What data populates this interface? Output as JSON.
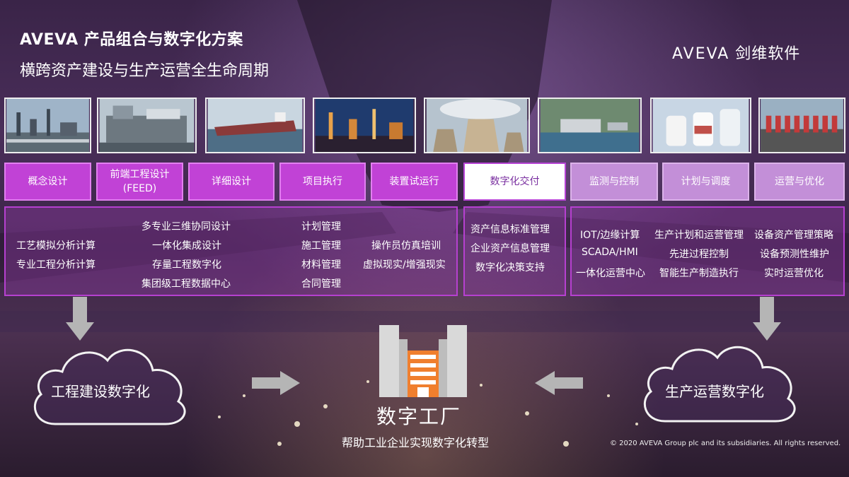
{
  "header": {
    "title": "AVEVA 产品组合与数字化方案",
    "subtitle": "横跨资产建设与生产运营全生命周期",
    "logo_brand": "AVEVA",
    "logo_cn": "剑维软件"
  },
  "stages": [
    {
      "label": "概念设计"
    },
    {
      "label": "前端工程设计\n(FEED)"
    },
    {
      "label": "详细设计"
    },
    {
      "label": "项目执行"
    },
    {
      "label": "装置试运行"
    },
    {
      "label": "数字化交付"
    },
    {
      "label": "监测与控制"
    },
    {
      "label": "计划与调度"
    },
    {
      "label": "运营与优化"
    }
  ],
  "panels": {
    "left": {
      "col1": [
        "工艺模拟分析计算",
        "专业工程分析计算"
      ],
      "col2": [
        "多专业三维协同设计",
        "一体化集成设计",
        "存量工程数字化",
        "集团级工程数据中心"
      ],
      "col3": [
        "计划管理",
        "施工管理",
        "材料管理",
        "合同管理"
      ],
      "col4": [
        "操作员仿真培训",
        "虚拟现实/增强现实"
      ]
    },
    "middle": [
      "资产信息标准管理",
      "企业资产信息管理",
      "数字化决策支持"
    ],
    "right": {
      "col1": [
        "IOT/边缘计算",
        "SCADA/HMI",
        "一体化运营中心"
      ],
      "col2": [
        "生产计划和运营管理",
        "先进过程控制",
        "智能生产制造执行"
      ],
      "col3": [
        "设备资产管理策略",
        "设备预测性维护",
        "实时运营优化"
      ]
    }
  },
  "bottom": {
    "cloud_left": "工程建设数字化",
    "cloud_right": "生产运营数字化",
    "factory_title": "数字工厂",
    "factory_subtitle": "帮助工业企业实现数字化转型",
    "copyright": "© 2020 AVEVA Group plc and its subsidiaries. All rights reserved."
  },
  "colors": {
    "stage": "#c142d6",
    "stage_light": "#c38fd8",
    "panel_border": "#b640d0",
    "factory_orange": "#f07f2e"
  }
}
